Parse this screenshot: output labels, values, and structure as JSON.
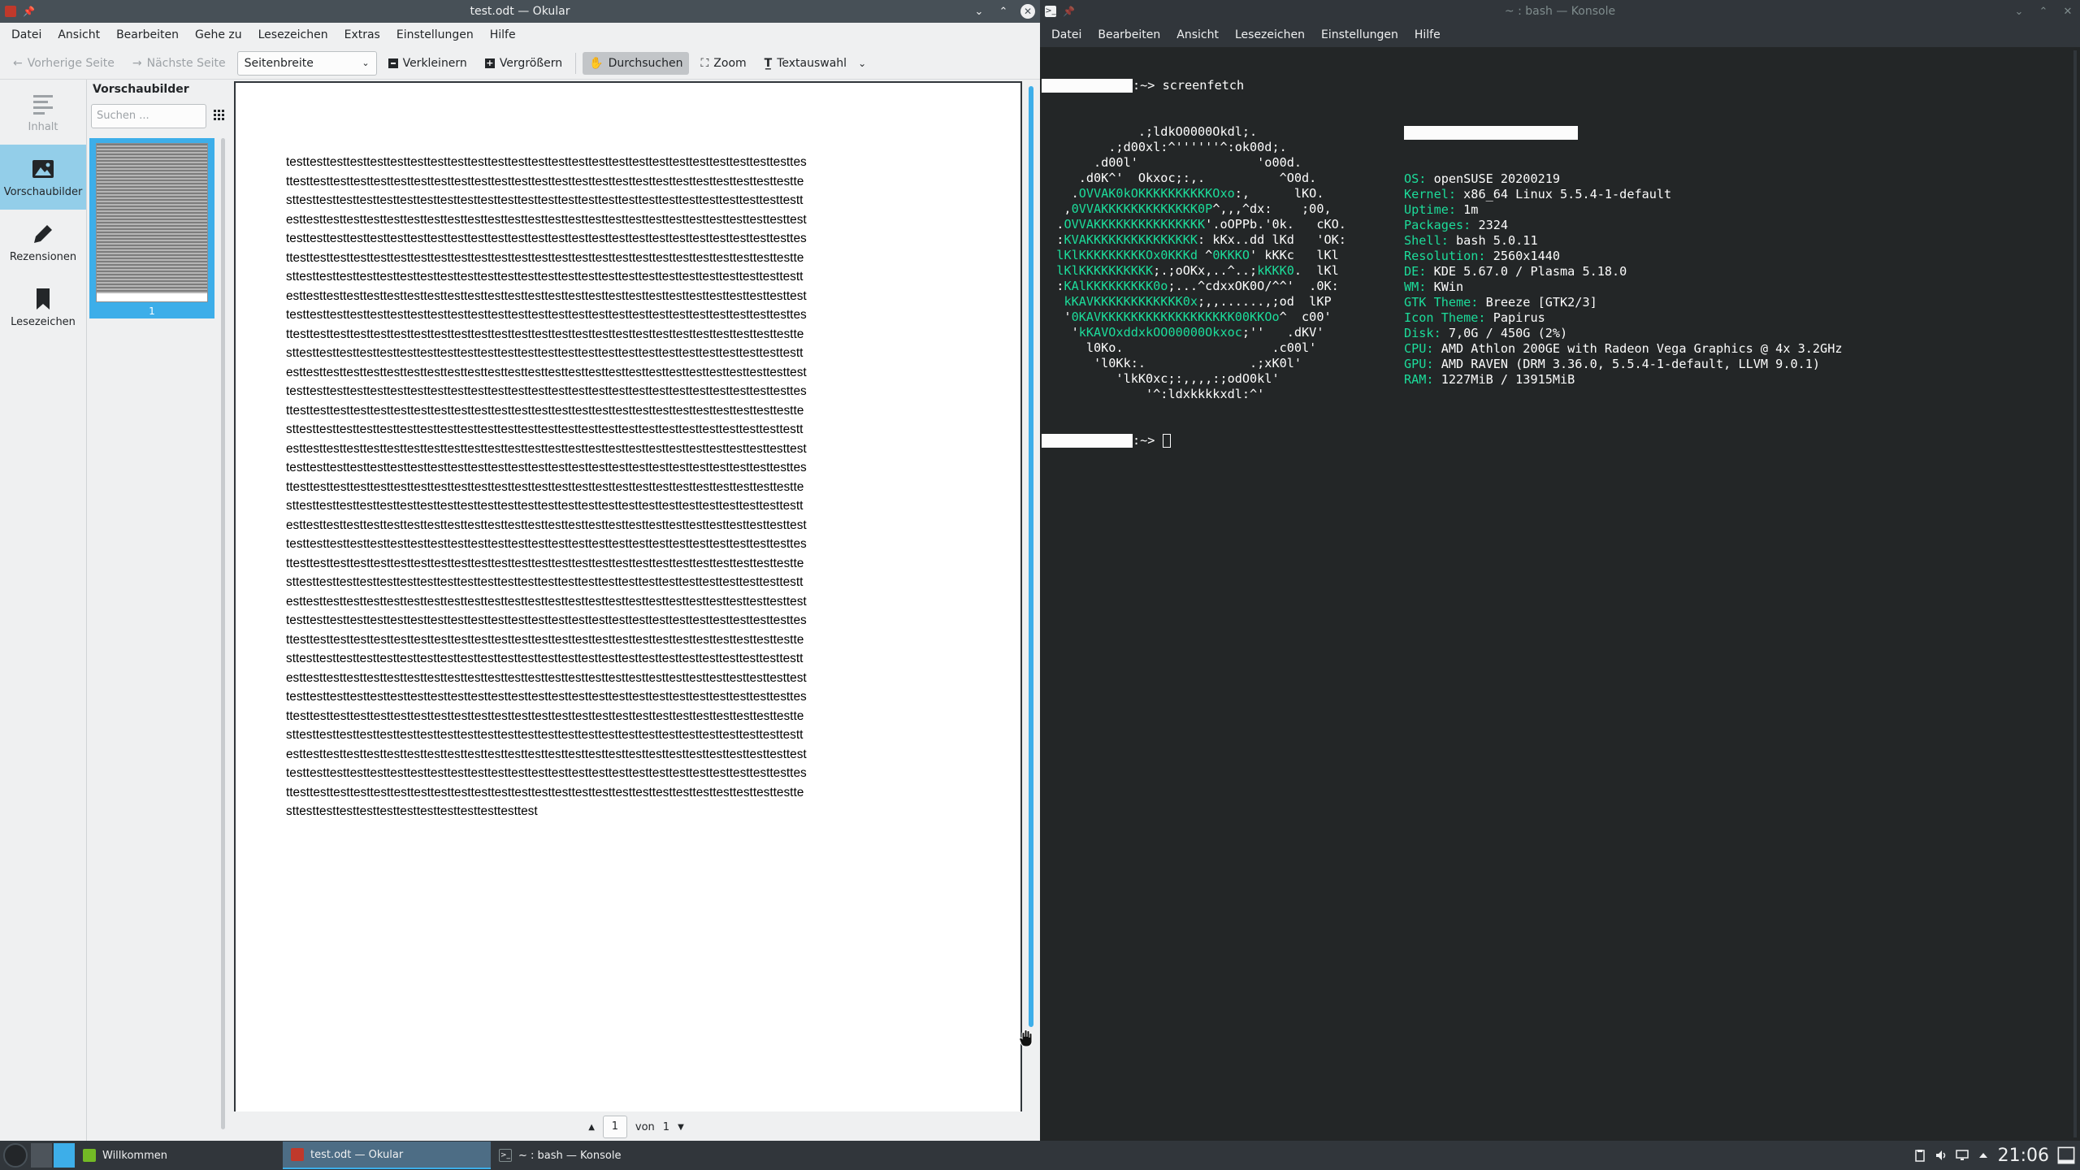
{
  "okular": {
    "title": "test.odt — Okular",
    "menu": [
      "Datei",
      "Ansicht",
      "Bearbeiten",
      "Gehe zu",
      "Lesezeichen",
      "Extras",
      "Einstellungen",
      "Hilfe"
    ],
    "toolbar": {
      "prev": "Vorherige Seite",
      "next": "Nächste Seite",
      "zoom_mode": "Seitenbreite",
      "zoom_out": "Verkleinern",
      "zoom_in": "Vergrößern",
      "browse": "Durchsuchen",
      "zoom": "Zoom",
      "text_select": "Textauswahl"
    },
    "sidebar": {
      "tabs": [
        "Inhalt",
        "Vorschaubilder",
        "Rezensionen",
        "Lesezeichen"
      ],
      "panel_title": "Vorschaubilder",
      "search_placeholder": "Suchen ...",
      "thumb_number": "1"
    },
    "document": {
      "lines": [
        "testtesttesttesttesttesttesttesttesttesttesttesttesttesttesttesttesttesttesttesttesttesttesttesttesttes",
        "ttesttesttesttesttesttesttesttesttesttesttesttesttesttesttesttesttesttesttesttesttesttesttesttesttestte",
        "sttesttesttesttesttesttesttesttesttesttesttesttesttesttesttesttesttesttesttesttesttesttesttesttesttestt",
        "esttesttesttesttesttesttesttesttesttesttesttesttesttesttesttesttesttesttesttesttesttesttesttesttesttest",
        "testtesttesttesttesttesttesttesttesttesttesttesttesttesttesttesttesttesttesttesttesttesttesttesttesttes",
        "ttesttesttesttesttesttesttesttesttesttesttesttesttesttesttesttesttesttesttesttesttesttesttesttesttestte",
        "sttesttesttesttesttesttesttesttesttesttesttesttesttesttesttesttesttesttesttesttesttesttesttesttesttestt",
        "esttesttesttesttesttesttesttesttesttesttesttesttesttesttesttesttesttesttesttesttesttesttesttesttesttest",
        "testtesttesttesttesttesttesttesttesttesttesttesttesttesttesttesttesttesttesttesttesttesttesttesttesttes",
        "ttesttesttesttesttesttesttesttesttesttesttesttesttesttesttesttesttesttesttesttesttesttesttesttesttestte",
        "sttesttesttesttesttesttesttesttesttesttesttesttesttesttesttesttesttesttesttesttesttesttesttesttesttestt",
        "esttesttesttesttesttesttesttesttesttesttesttesttesttesttesttesttesttesttesttesttesttesttesttesttesttest",
        "testtesttesttesttesttesttesttesttesttesttesttesttesttesttesttesttesttesttesttesttesttesttesttesttesttes",
        "ttesttesttesttesttesttesttesttesttesttesttesttesttesttesttesttesttesttesttesttesttesttesttesttesttestte",
        "sttesttesttesttesttesttesttesttesttesttesttesttesttesttesttesttesttesttesttesttesttesttesttesttesttestt",
        "esttesttesttesttesttesttesttesttesttesttesttesttesttesttesttesttesttesttesttesttesttesttesttesttesttest",
        "testtesttesttesttesttesttesttesttesttesttesttesttesttesttesttesttesttesttesttesttesttesttesttesttesttes",
        "ttesttesttesttesttesttesttesttesttesttesttesttesttesttesttesttesttesttesttesttesttesttesttesttesttestte",
        "sttesttesttesttesttesttesttesttesttesttesttesttesttesttesttesttesttesttesttesttesttesttesttesttesttestt",
        "esttesttesttesttesttesttesttesttesttesttesttesttesttesttesttesttesttesttesttesttesttesttesttesttesttest",
        "testtesttesttesttesttesttesttesttesttesttesttesttesttesttesttesttesttesttesttesttesttesttesttesttesttes",
        "ttesttesttesttesttesttesttesttesttesttesttesttesttesttesttesttesttesttesttesttesttesttesttesttesttestte",
        "sttesttesttesttesttesttesttesttesttesttesttesttesttesttesttesttesttesttesttesttesttesttesttesttesttestt",
        "esttesttesttesttesttesttesttesttesttesttesttesttesttesttesttesttesttesttesttesttesttesttesttesttesttest",
        "testtesttesttesttesttesttesttesttesttesttesttesttesttesttesttesttesttesttesttesttesttesttesttesttesttes",
        "ttesttesttesttesttesttesttesttesttesttesttesttesttesttesttesttesttesttesttesttesttesttesttesttesttestte",
        "sttesttesttesttesttesttesttesttesttesttesttesttesttesttesttesttesttesttesttesttesttesttesttesttesttestt",
        "esttesttesttesttesttesttesttesttesttesttesttesttesttesttesttesttesttesttesttesttesttesttesttesttesttest",
        "testtesttesttesttesttesttesttesttesttesttesttesttesttesttesttesttesttesttesttesttesttesttesttesttesttes",
        "ttesttesttesttesttesttesttesttesttesttesttesttesttesttesttesttesttesttesttesttesttesttesttesttesttestte",
        "sttesttesttesttesttesttesttesttesttesttesttesttesttesttesttesttesttesttesttesttesttesttesttesttesttestt",
        "esttesttesttesttesttesttesttesttesttesttesttesttesttesttesttesttesttesttesttesttesttesttesttesttesttest",
        "testtesttesttesttesttesttesttesttesttesttesttesttesttesttesttesttesttesttesttesttesttesttesttesttesttes",
        "ttesttesttesttesttesttesttesttesttesttesttesttesttesttesttesttesttesttesttesttesttesttesttesttesttestte",
        "sttesttesttesttesttesttesttesttesttesttesttesttest"
      ]
    },
    "pagebar": {
      "current": "1",
      "of_label": "von",
      "total": "1"
    }
  },
  "konsole": {
    "title": "~ : bash — Konsole",
    "menu": [
      "Datei",
      "Bearbeiten",
      "Ansicht",
      "Lesezeichen",
      "Einstellungen",
      "Hilfe"
    ],
    "command": ":~> screenfetch",
    "logo": [
      "             .;ldkO0000Okdl;.",
      "         .;d00xl:^''''''^:ok00d;.",
      "       .d00l'                'o00d.",
      "     .d0K^'  Okxoc;:,.          ^O0d.",
      "    .OVVAK0kOKKKKKKKKKKOxo:,      lKO.",
      "   ,0VVAKKKKKKKKKKKKK0P^,,,^dx:    ;00,",
      "  .OVVAKKKKKKKKKKKKKKK'.oOPPb.'0k.   cKO.",
      "  :KVAKKKKKKKKKKKKKKK: kKx..dd lKd   'OK:",
      "  lKlKKKKKKKKKOx0KKKd ^0KKKO' kKKc   lKl",
      "  lKlKKKKKKKKKK;.;oOKx,..^..;kKKK0.  lKl",
      "  :KAlKKKKKKKKK0o;...^cdxxOK0O/^^'  .0K:",
      "   kKAVKKKKKKKKKKKK0x;,,......,;od  lKP",
      "   '0KAVKKKKKKKKKKKKKKKKKK00KKOo^  c00'",
      "    'kKAVOxddxkOO00000Okxoc;''   .dKV'",
      "      l0Ko.                    .c00l'",
      "       'l0Kk:.              .;xK0l'",
      "          'lkK0xc;:,,,,:;odO0kl'",
      "              '^:ldxkkkkxdl:^'"
    ],
    "info": [
      {
        "k": "OS:",
        "v": " openSUSE 20200219"
      },
      {
        "k": "Kernel:",
        "v": " x86_64 Linux 5.5.4-1-default"
      },
      {
        "k": "Uptime:",
        "v": " 1m"
      },
      {
        "k": "Packages:",
        "v": " 2324"
      },
      {
        "k": "Shell:",
        "v": " bash 5.0.11"
      },
      {
        "k": "Resolution:",
        "v": " 2560x1440"
      },
      {
        "k": "DE:",
        "v": " KDE 5.67.0 / Plasma 5.18.0"
      },
      {
        "k": "WM:",
        "v": " KWin"
      },
      {
        "k": "GTK Theme:",
        "v": " Breeze [GTK2/3]"
      },
      {
        "k": "Icon Theme:",
        "v": " Papirus"
      },
      {
        "k": "Disk:",
        "v": " 7,0G / 450G (2%)"
      },
      {
        "k": "CPU:",
        "v": " AMD Athlon 200GE with Radeon Vega Graphics @ 4x 3.2GHz"
      },
      {
        "k": "GPU:",
        "v": " AMD RAVEN (DRM 3.36.0, 5.5.4-1-default, LLVM 9.0.1)"
      },
      {
        "k": "RAM:",
        "v": " 1227MiB / 13915MiB"
      }
    ],
    "prompt": ":~>"
  },
  "taskbar": {
    "tasks": [
      "Willkommen",
      "test.odt — Okular",
      "~ : bash — Konsole"
    ],
    "clock": "21:06"
  },
  "colors": {
    "accent": "#3daee9",
    "term_green": "#1cdc9a",
    "term_bg": "#232627"
  }
}
